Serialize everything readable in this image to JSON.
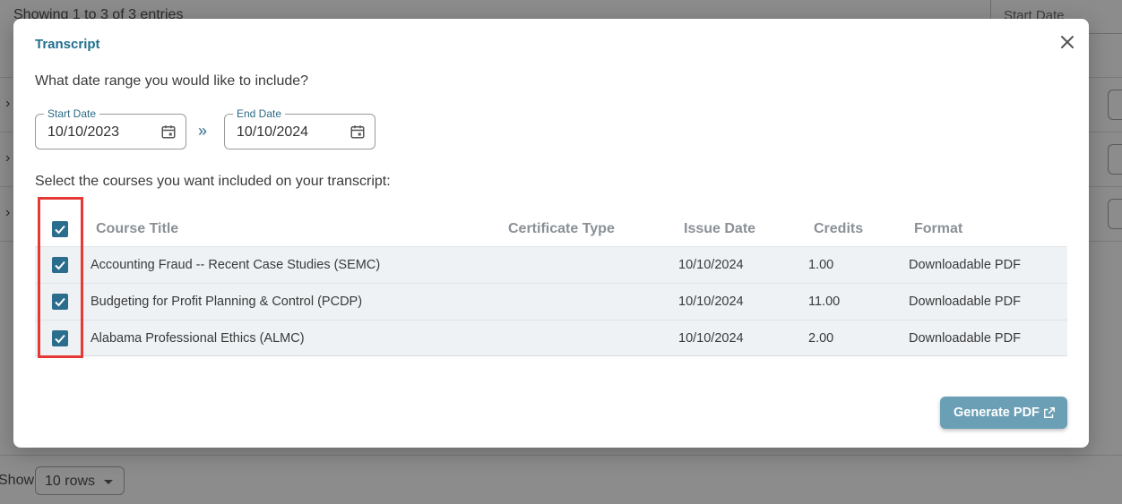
{
  "background": {
    "entries_text": "Showing 1 to 3 of 3 entries",
    "start_date_label": "Start Date",
    "show_label": "Show",
    "rows_select_value": "10 rows"
  },
  "modal": {
    "title": "Transcript",
    "question": "What date range you would like to include?",
    "start_date": {
      "label": "Start Date",
      "value": "10/10/2023"
    },
    "end_date": {
      "label": "End Date",
      "value": "10/10/2024"
    },
    "range_separator": "»",
    "select_label": "Select the courses you want included on your transcript:",
    "table": {
      "columns": [
        "Course Title",
        "Certificate Type",
        "Issue Date",
        "Credits",
        "Format"
      ],
      "rows": [
        {
          "title": "Accounting Fraud -- Recent Case Studies (SEMC)",
          "certificate_type": "",
          "issue_date": "10/10/2024",
          "credits": "1.00",
          "format": "Downloadable PDF",
          "checked": true
        },
        {
          "title": "Budgeting for Profit Planning & Control (PCDP)",
          "certificate_type": "",
          "issue_date": "10/10/2024",
          "credits": "11.00",
          "format": "Downloadable PDF",
          "checked": true
        },
        {
          "title": "Alabama Professional Ethics (ALMC)",
          "certificate_type": "",
          "issue_date": "10/10/2024",
          "credits": "2.00",
          "format": "Downloadable PDF",
          "checked": true
        }
      ],
      "select_all_checked": true
    },
    "generate_button": "Generate PDF",
    "icons": {
      "close": "close-icon",
      "calendar": "calendar-icon",
      "external": "external-link-icon",
      "check": "checkbox-checked-icon"
    },
    "colors": {
      "accent": "#2a6d8c",
      "title": "#1f6f8f",
      "button": "#6a9fb5",
      "highlight": "#e53935"
    }
  }
}
